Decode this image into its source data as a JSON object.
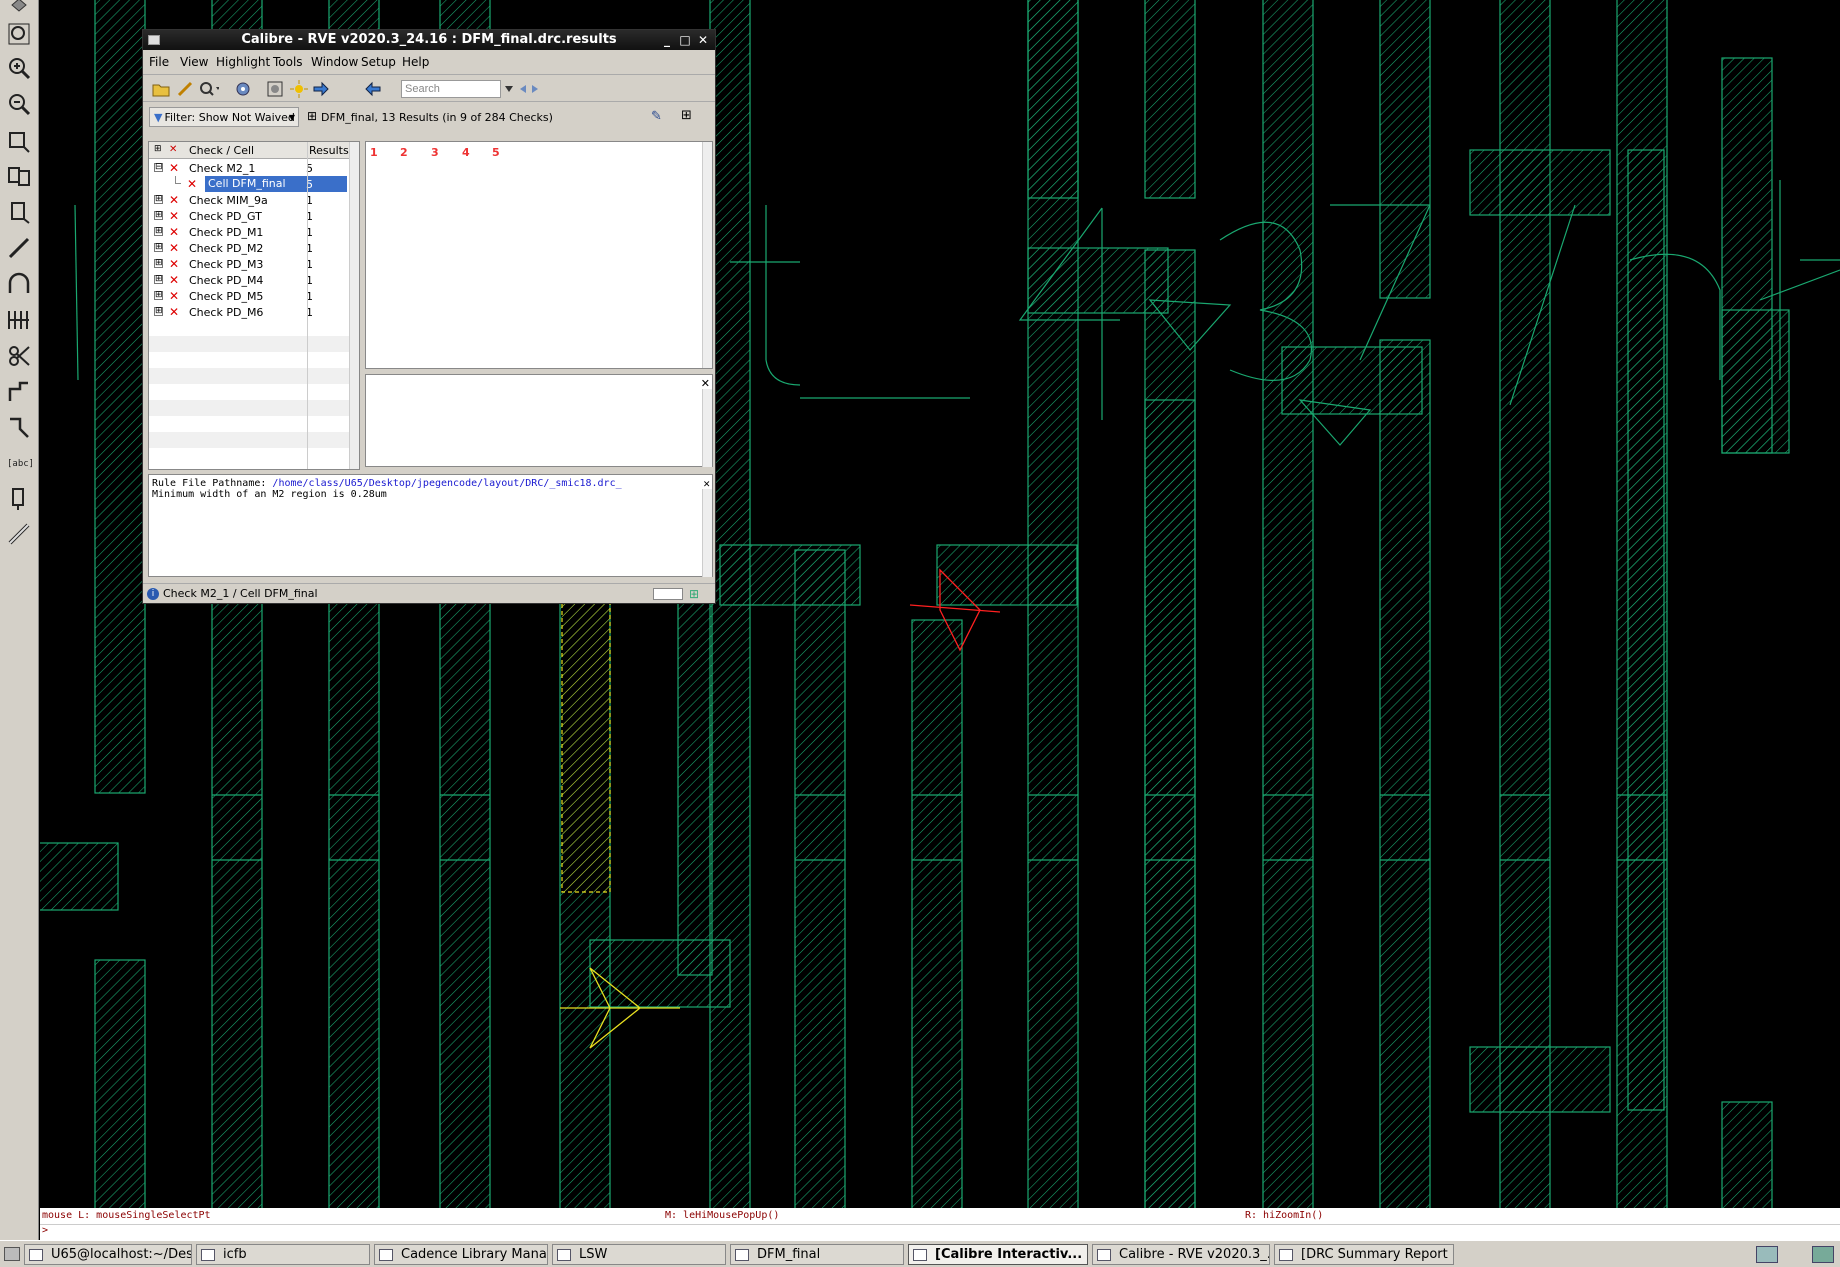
{
  "rve": {
    "title": "Calibre - RVE v2020.3_24.16 : DFM_final.drc.results",
    "menu": [
      "File",
      "View",
      "Highlight",
      "Tools",
      "Window",
      "Setup",
      "Help"
    ],
    "search_placeholder": "Search",
    "filter": "Filter: Show Not Waived",
    "summary": "DFM_final, 13 Results (in 9 of 284 Checks)",
    "tree_headers": {
      "check_cell": "Check / Cell",
      "results": "Results"
    },
    "tree_rows": [
      {
        "label": "Check M2_1",
        "results": "5",
        "expander": "⊟",
        "level": 0
      },
      {
        "label": "Cell DFM_final",
        "results": "5",
        "expander": "",
        "level": 1,
        "selected": true
      },
      {
        "label": "Check MIM_9a",
        "results": "1",
        "expander": "⊞",
        "level": 0
      },
      {
        "label": "Check PD_GT",
        "results": "1",
        "expander": "⊞",
        "level": 0
      },
      {
        "label": "Check PD_M1",
        "results": "1",
        "expander": "⊞",
        "level": 0
      },
      {
        "label": "Check PD_M2",
        "results": "1",
        "expander": "⊞",
        "level": 0
      },
      {
        "label": "Check PD_M3",
        "results": "1",
        "expander": "⊞",
        "level": 0
      },
      {
        "label": "Check PD_M4",
        "results": "1",
        "expander": "⊞",
        "level": 0
      },
      {
        "label": "Check PD_M5",
        "results": "1",
        "expander": "⊞",
        "level": 0
      },
      {
        "label": "Check PD_M6",
        "results": "1",
        "expander": "⊞",
        "level": 0
      }
    ],
    "result_numbers": [
      "1",
      "2",
      "3",
      "4",
      "5"
    ],
    "rule_label": "Rule File Pathname:",
    "rule_path": "/home/class/U65/Desktop/jpegencode/layout/DRC/_smic18.drc_",
    "rule_desc": "Minimum width of an M2 region is 0.28um",
    "status": "Check M2_1 / Cell DFM_final"
  },
  "mouse_bar": {
    "left": "mouse L: mouseSingleSelectPt",
    "middle": "M: leHiMousePopUp()",
    "right": "R: hiZoomIn()"
  },
  "cmd_prompt": ">",
  "taskbar": [
    {
      "label": "U65@localhost:~/Des...",
      "active": false
    },
    {
      "label": "icfb",
      "active": false
    },
    {
      "label": "Cadence Library Mana...",
      "active": false
    },
    {
      "label": "LSW",
      "active": false
    },
    {
      "label": "DFM_final",
      "active": false
    },
    {
      "label": "[Calibre Interactiv...",
      "active": true
    },
    {
      "label": "Calibre - RVE v2020.3_...",
      "active": false
    },
    {
      "label": "[DRC Summary Report ...",
      "active": false
    }
  ],
  "colors": {
    "metal": "#1aa870",
    "error_red": "#ff2020",
    "highlight_yellow": "#e8e020",
    "selection": "#3a6fc9"
  }
}
